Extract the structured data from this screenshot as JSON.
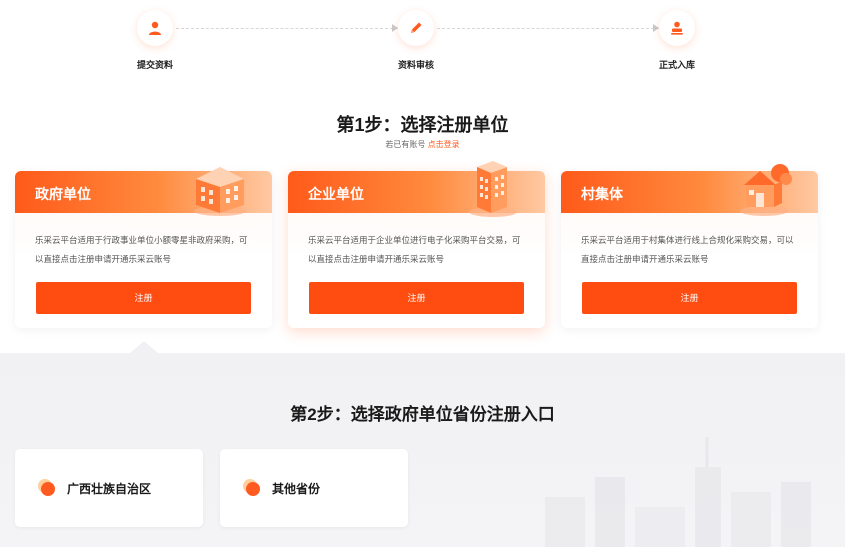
{
  "stepper": {
    "steps": [
      {
        "label": "提交资料",
        "icon": "user-icon"
      },
      {
        "label": "资料审核",
        "icon": "pencil-icon"
      },
      {
        "label": "正式入库",
        "icon": "user-stamp-icon"
      }
    ]
  },
  "step1": {
    "title": "第1步：选择注册单位",
    "login_hint_prefix": "若已有账号",
    "login_link": "点击登录"
  },
  "cards": [
    {
      "title": "政府单位",
      "icon": "government-building-icon",
      "desc": "乐采云平台适用于行政事业单位小额零星非政府采购，可以直接点击注册申请开通乐采云账号",
      "button": "注册"
    },
    {
      "title": "企业单位",
      "icon": "office-tower-icon",
      "desc": "乐采云平台适用于企业单位进行电子化采购平台交易，可以直接点击注册申请开通乐采云账号",
      "button": "注册"
    },
    {
      "title": "村集体",
      "icon": "village-house-icon",
      "desc": "乐采云平台适用于村集体进行线上合规化采购交易，可以直接点击注册申请开通乐采云账号",
      "button": "注册"
    }
  ],
  "step2": {
    "title": "第2步：选择政府单位省份注册入口",
    "provinces": [
      {
        "name": "广西壮族自治区"
      },
      {
        "name": "其他省份"
      }
    ]
  },
  "colors": {
    "accent": "#ff4d12",
    "accent_light": "#ff8a3d",
    "section_bg": "#f1f1f3"
  }
}
